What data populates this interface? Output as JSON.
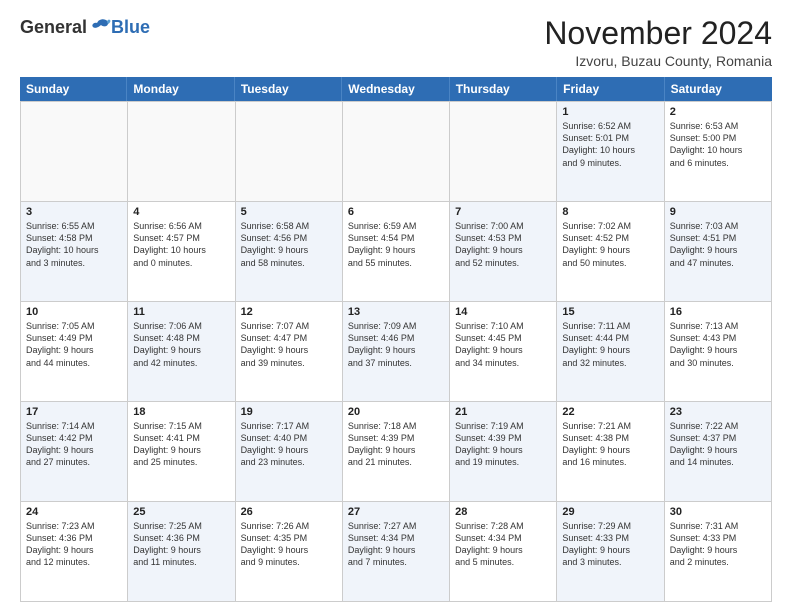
{
  "header": {
    "logo_general": "General",
    "logo_blue": "Blue",
    "title": "November 2024",
    "location": "Izvoru, Buzau County, Romania"
  },
  "calendar": {
    "weekdays": [
      "Sunday",
      "Monday",
      "Tuesday",
      "Wednesday",
      "Thursday",
      "Friday",
      "Saturday"
    ],
    "rows": [
      [
        {
          "day": "",
          "info": "",
          "empty": true
        },
        {
          "day": "",
          "info": "",
          "empty": true
        },
        {
          "day": "",
          "info": "",
          "empty": true
        },
        {
          "day": "",
          "info": "",
          "empty": true
        },
        {
          "day": "",
          "info": "",
          "empty": true
        },
        {
          "day": "1",
          "info": "Sunrise: 6:52 AM\nSunset: 5:01 PM\nDaylight: 10 hours\nand 9 minutes.",
          "shaded": true
        },
        {
          "day": "2",
          "info": "Sunrise: 6:53 AM\nSunset: 5:00 PM\nDaylight: 10 hours\nand 6 minutes.",
          "shaded": false
        }
      ],
      [
        {
          "day": "3",
          "info": "Sunrise: 6:55 AM\nSunset: 4:58 PM\nDaylight: 10 hours\nand 3 minutes.",
          "shaded": true
        },
        {
          "day": "4",
          "info": "Sunrise: 6:56 AM\nSunset: 4:57 PM\nDaylight: 10 hours\nand 0 minutes.",
          "shaded": false
        },
        {
          "day": "5",
          "info": "Sunrise: 6:58 AM\nSunset: 4:56 PM\nDaylight: 9 hours\nand 58 minutes.",
          "shaded": true
        },
        {
          "day": "6",
          "info": "Sunrise: 6:59 AM\nSunset: 4:54 PM\nDaylight: 9 hours\nand 55 minutes.",
          "shaded": false
        },
        {
          "day": "7",
          "info": "Sunrise: 7:00 AM\nSunset: 4:53 PM\nDaylight: 9 hours\nand 52 minutes.",
          "shaded": true
        },
        {
          "day": "8",
          "info": "Sunrise: 7:02 AM\nSunset: 4:52 PM\nDaylight: 9 hours\nand 50 minutes.",
          "shaded": false
        },
        {
          "day": "9",
          "info": "Sunrise: 7:03 AM\nSunset: 4:51 PM\nDaylight: 9 hours\nand 47 minutes.",
          "shaded": true
        }
      ],
      [
        {
          "day": "10",
          "info": "Sunrise: 7:05 AM\nSunset: 4:49 PM\nDaylight: 9 hours\nand 44 minutes.",
          "shaded": false
        },
        {
          "day": "11",
          "info": "Sunrise: 7:06 AM\nSunset: 4:48 PM\nDaylight: 9 hours\nand 42 minutes.",
          "shaded": true
        },
        {
          "day": "12",
          "info": "Sunrise: 7:07 AM\nSunset: 4:47 PM\nDaylight: 9 hours\nand 39 minutes.",
          "shaded": false
        },
        {
          "day": "13",
          "info": "Sunrise: 7:09 AM\nSunset: 4:46 PM\nDaylight: 9 hours\nand 37 minutes.",
          "shaded": true
        },
        {
          "day": "14",
          "info": "Sunrise: 7:10 AM\nSunset: 4:45 PM\nDaylight: 9 hours\nand 34 minutes.",
          "shaded": false
        },
        {
          "day": "15",
          "info": "Sunrise: 7:11 AM\nSunset: 4:44 PM\nDaylight: 9 hours\nand 32 minutes.",
          "shaded": true
        },
        {
          "day": "16",
          "info": "Sunrise: 7:13 AM\nSunset: 4:43 PM\nDaylight: 9 hours\nand 30 minutes.",
          "shaded": false
        }
      ],
      [
        {
          "day": "17",
          "info": "Sunrise: 7:14 AM\nSunset: 4:42 PM\nDaylight: 9 hours\nand 27 minutes.",
          "shaded": true
        },
        {
          "day": "18",
          "info": "Sunrise: 7:15 AM\nSunset: 4:41 PM\nDaylight: 9 hours\nand 25 minutes.",
          "shaded": false
        },
        {
          "day": "19",
          "info": "Sunrise: 7:17 AM\nSunset: 4:40 PM\nDaylight: 9 hours\nand 23 minutes.",
          "shaded": true
        },
        {
          "day": "20",
          "info": "Sunrise: 7:18 AM\nSunset: 4:39 PM\nDaylight: 9 hours\nand 21 minutes.",
          "shaded": false
        },
        {
          "day": "21",
          "info": "Sunrise: 7:19 AM\nSunset: 4:39 PM\nDaylight: 9 hours\nand 19 minutes.",
          "shaded": true
        },
        {
          "day": "22",
          "info": "Sunrise: 7:21 AM\nSunset: 4:38 PM\nDaylight: 9 hours\nand 16 minutes.",
          "shaded": false
        },
        {
          "day": "23",
          "info": "Sunrise: 7:22 AM\nSunset: 4:37 PM\nDaylight: 9 hours\nand 14 minutes.",
          "shaded": true
        }
      ],
      [
        {
          "day": "24",
          "info": "Sunrise: 7:23 AM\nSunset: 4:36 PM\nDaylight: 9 hours\nand 12 minutes.",
          "shaded": false
        },
        {
          "day": "25",
          "info": "Sunrise: 7:25 AM\nSunset: 4:36 PM\nDaylight: 9 hours\nand 11 minutes.",
          "shaded": true
        },
        {
          "day": "26",
          "info": "Sunrise: 7:26 AM\nSunset: 4:35 PM\nDaylight: 9 hours\nand 9 minutes.",
          "shaded": false
        },
        {
          "day": "27",
          "info": "Sunrise: 7:27 AM\nSunset: 4:34 PM\nDaylight: 9 hours\nand 7 minutes.",
          "shaded": true
        },
        {
          "day": "28",
          "info": "Sunrise: 7:28 AM\nSunset: 4:34 PM\nDaylight: 9 hours\nand 5 minutes.",
          "shaded": false
        },
        {
          "day": "29",
          "info": "Sunrise: 7:29 AM\nSunset: 4:33 PM\nDaylight: 9 hours\nand 3 minutes.",
          "shaded": true
        },
        {
          "day": "30",
          "info": "Sunrise: 7:31 AM\nSunset: 4:33 PM\nDaylight: 9 hours\nand 2 minutes.",
          "shaded": false
        }
      ]
    ]
  }
}
